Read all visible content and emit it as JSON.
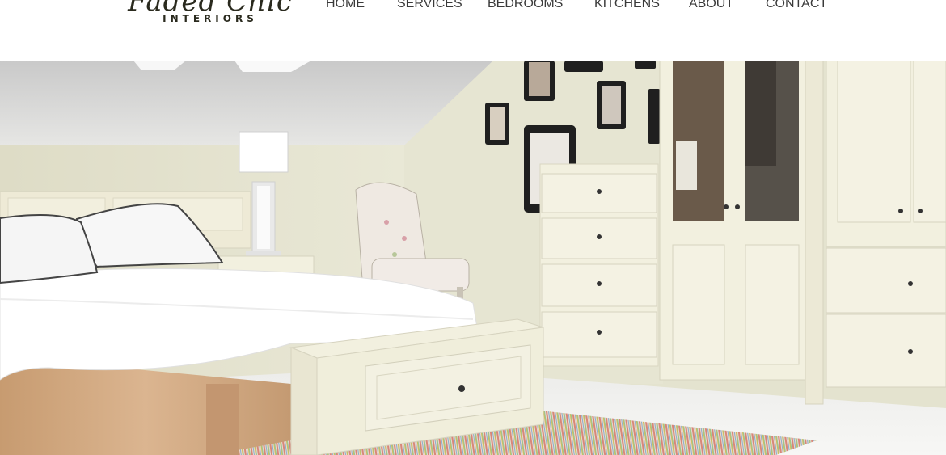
{
  "logo": {
    "script": "Faded Chic",
    "sub": "INTERIORS"
  },
  "nav": {
    "items": [
      {
        "label": "HOME"
      },
      {
        "label": "SERVICES"
      },
      {
        "label": "BEDROOMS"
      },
      {
        "label": "KITCHENS"
      },
      {
        "label": "ABOUT"
      },
      {
        "label": "CONTACT"
      }
    ]
  },
  "colors": {
    "nav_text": "#3a3a3a",
    "wall": "#e4e3cf",
    "furniture_cream": "#f2f0df",
    "floor": "#f3f3f1",
    "bed_wood": "#cfa77f"
  }
}
